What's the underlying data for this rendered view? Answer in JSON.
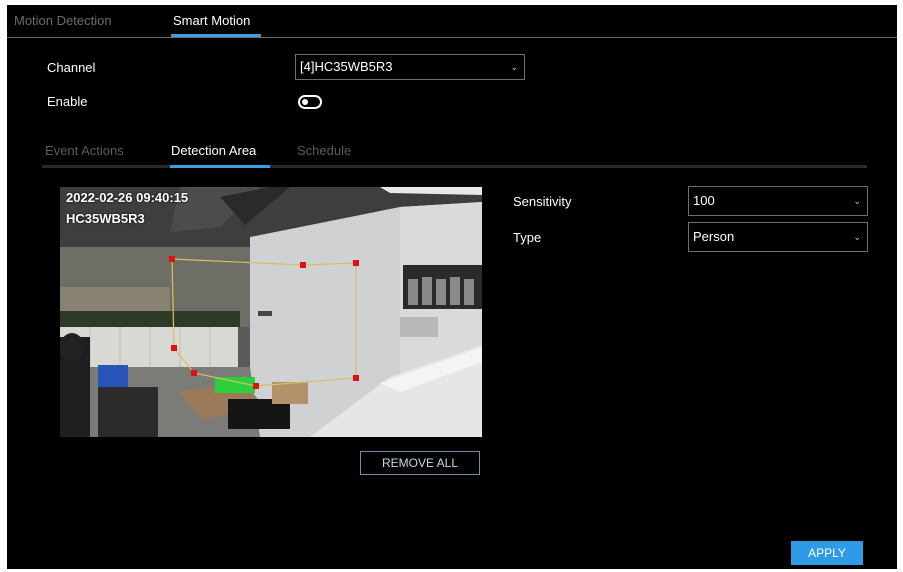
{
  "top_tabs": [
    {
      "label": "Motion Detection",
      "active": false
    },
    {
      "label": "Smart Motion",
      "active": true
    }
  ],
  "channel": {
    "label": "Channel",
    "value": "[4]HC35WB5R3"
  },
  "enable": {
    "label": "Enable",
    "on": false
  },
  "sub_tabs": [
    {
      "label": "Event Actions",
      "active": false
    },
    {
      "label": "Detection Area",
      "active": true
    },
    {
      "label": "Schedule",
      "active": false
    }
  ],
  "video": {
    "timestamp": "2022-02-26 09:40:15",
    "camera_name": "HC35WB5R3"
  },
  "sensitivity": {
    "label": "Sensitivity",
    "value": "100"
  },
  "type": {
    "label": "Type",
    "value": "Person"
  },
  "buttons": {
    "remove_all": "REMOVE ALL",
    "apply": "APPLY"
  },
  "colors": {
    "accent": "#3aa0e6",
    "apply_bg": "#2f9be6",
    "handle": "#e01010",
    "region_line": "#d8c060"
  },
  "icons": {
    "dropdown": "chevron-down-icon",
    "toggle": "toggle-switch-icon"
  }
}
